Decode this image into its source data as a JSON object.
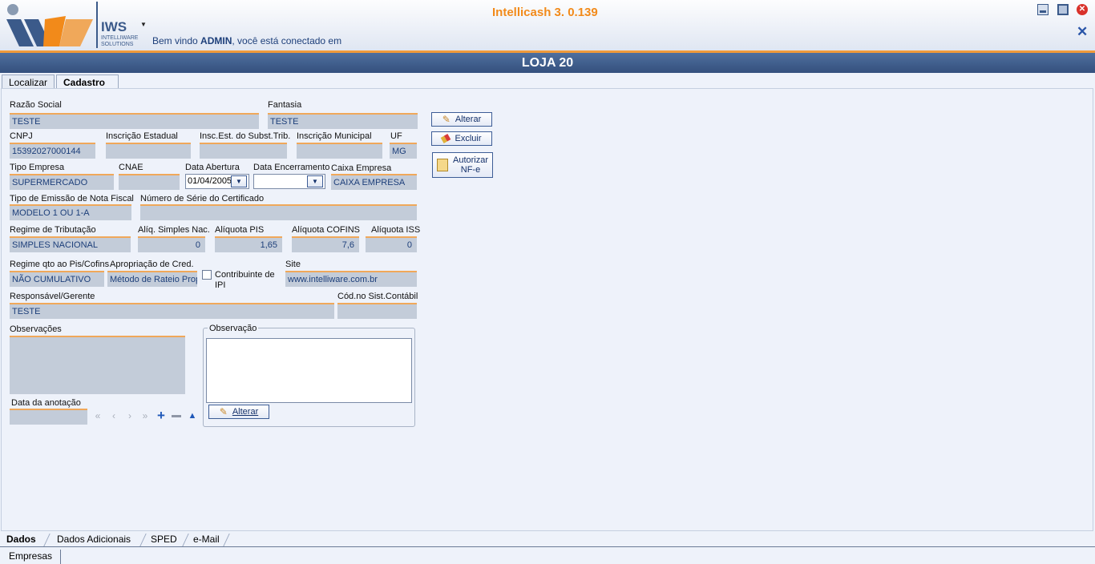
{
  "header": {
    "app_title": "Intellicash 3. 0.139",
    "welcome_prefix": "Bem vindo ",
    "welcome_user": "ADMIN",
    "welcome_suffix": ", você está conectado em",
    "logo_text": "IWS",
    "logo_sub1": "INTELLIWARE",
    "logo_sub2": "SOLUTIONS"
  },
  "titlebar": {
    "title": "LOJA 20"
  },
  "top_tabs": {
    "localizar": "Localizar",
    "cadastro": "Cadastro"
  },
  "form": {
    "razao_social": {
      "label": "Razão Social",
      "value": "TESTE"
    },
    "fantasia": {
      "label": "Fantasia",
      "value": "TESTE"
    },
    "cnpj": {
      "label": "CNPJ",
      "value": "15392027000144"
    },
    "inscricao_estadual": {
      "label": "Inscrição Estadual",
      "value": ""
    },
    "insc_subst_trib": {
      "label": "Insc.Est. do Subst.Trib.",
      "value": ""
    },
    "inscricao_municipal": {
      "label": "Inscrição Municipal",
      "value": ""
    },
    "uf": {
      "label": "UF",
      "value": "MG"
    },
    "tipo_empresa": {
      "label": "Tipo Empresa",
      "value": "SUPERMERCADO"
    },
    "cnae": {
      "label": "CNAE",
      "value": ""
    },
    "data_abertura": {
      "label": "Data Abertura",
      "value": "01/04/2005"
    },
    "data_encerramento": {
      "label": "Data Encerramento",
      "value": ""
    },
    "caixa_empresa": {
      "label": "Caixa Empresa",
      "value": "CAIXA EMPRESA"
    },
    "tipo_emissao": {
      "label": "Tipo de Emissão de Nota Fiscal",
      "value": "MODELO 1 OU 1-A"
    },
    "numero_serie": {
      "label": "Número de Série do Certificado",
      "value": ""
    },
    "regime_tributacao": {
      "label": "Regime de Tributação",
      "value": "SIMPLES NACIONAL"
    },
    "aliq_simples": {
      "label": "Alíq. Simples Nac.",
      "value": "0"
    },
    "aliquota_pis": {
      "label": "Alíquota PIS",
      "value": "1,65"
    },
    "aliquota_cofins": {
      "label": "Alíquota COFINS",
      "value": "7,6"
    },
    "aliquota_iss": {
      "label": "Alíquota ISS",
      "value": "0"
    },
    "regime_pis_cofins": {
      "label": "Regime qto ao Pis/Cofins",
      "value": "NÃO CUMULATIVO"
    },
    "apropriacao_cred": {
      "label": "Apropriação de Cred.",
      "value": "Método de Rateio Proporcional"
    },
    "contribuinte_ipi": {
      "label": "Contribuinte de IPI",
      "checked": false
    },
    "site": {
      "label": "Site",
      "value": "www.intelliware.com.br"
    },
    "responsavel": {
      "label": "Responsável/Gerente",
      "value": "TESTE"
    },
    "cod_sist_contabil": {
      "label": "Cód.no Sist.Contábil",
      "value": ""
    },
    "observacoes": {
      "label": "Observações",
      "value": ""
    },
    "data_anotacao": {
      "label": "Data da anotação",
      "value": ""
    }
  },
  "observacao_group": {
    "title": "Observação",
    "value": "",
    "button": "Alterar"
  },
  "actions": {
    "alterar": "Alterar",
    "excluir": "Excluir",
    "autorizar_line1": "Autorizar",
    "autorizar_line2": "NF-e"
  },
  "bottom_tabs": {
    "dados": "Dados",
    "dados_adicionais": "Dados Adicionais",
    "sped": "SPED",
    "email": "e-Mail"
  },
  "footer_tab": {
    "empresas": "Empresas"
  },
  "colors": {
    "accent_orange": "#f28a1a",
    "titlebar_blue": "#3b5a8a",
    "field_bg": "#c3ccd9",
    "field_accent": "#f0a85a"
  }
}
